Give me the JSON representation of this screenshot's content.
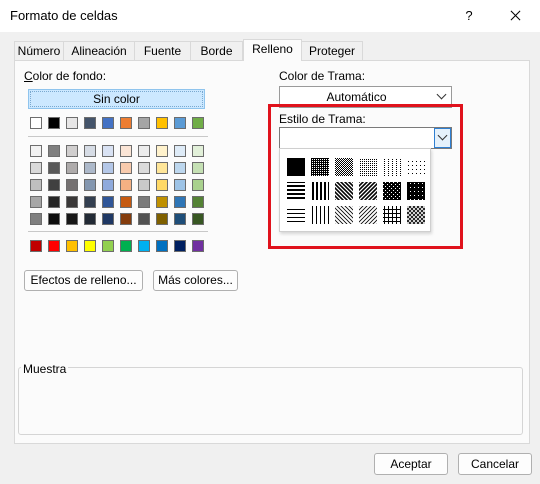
{
  "window": {
    "title": "Formato de celdas",
    "help": "?"
  },
  "tabs": [
    {
      "label": "Número"
    },
    {
      "label": "Alineación"
    },
    {
      "label": "Fuente"
    },
    {
      "label": "Borde"
    },
    {
      "label": "Relleno"
    },
    {
      "label": "Proteger"
    }
  ],
  "active_tab": "Relleno",
  "fill": {
    "background_label": "Color de fondo:",
    "no_color_label": "Sin color",
    "theme_top_row": [
      "#ffffff",
      "#000000",
      "#e7e6e6",
      "#44546a",
      "#4472c4",
      "#ed7d31",
      "#a5a5a5",
      "#ffc000",
      "#5b9bd5",
      "#70ad47"
    ],
    "theme_shades": [
      [
        "#f2f2f2",
        "#7f7f7f",
        "#d0cece",
        "#d6dce5",
        "#d9e2f3",
        "#fbe5d6",
        "#ededed",
        "#fff2cc",
        "#deebf7",
        "#e2f0d9"
      ],
      [
        "#d9d9d9",
        "#595959",
        "#aeabab",
        "#adb9ca",
        "#b4c7e7",
        "#f8cbad",
        "#dbdbdb",
        "#ffe699",
        "#bdd7ee",
        "#c5e0b4"
      ],
      [
        "#bfbfbf",
        "#404040",
        "#757171",
        "#8497b0",
        "#8faadc",
        "#f4b183",
        "#c9c9c9",
        "#ffd966",
        "#9dc3e6",
        "#a9d18e"
      ],
      [
        "#a6a6a6",
        "#262626",
        "#3a3838",
        "#333f50",
        "#2f5597",
        "#c55a11",
        "#7b7b7b",
        "#bf9000",
        "#2e75b6",
        "#548235"
      ],
      [
        "#7f7f7f",
        "#0d0d0d",
        "#171717",
        "#222a35",
        "#1f3864",
        "#843c0c",
        "#525252",
        "#7f6000",
        "#1f4e79",
        "#385723"
      ]
    ],
    "standard_colors": [
      "#c00000",
      "#ff0000",
      "#ffc000",
      "#ffff00",
      "#92d050",
      "#00b050",
      "#00b0f0",
      "#0070c0",
      "#002060",
      "#7030a0"
    ],
    "effects_button": "Efectos de relleno...",
    "more_colors_button": "Más colores..."
  },
  "pattern": {
    "color_label": "Color de Trama:",
    "color_value": "Automático",
    "style_label": "Estilo de Trama:",
    "style_value": "",
    "patterns": [
      [
        "solid",
        "75-gray",
        "50-gray",
        "25-gray",
        "12-gray",
        "6-gray"
      ],
      [
        "h-stripe",
        "v-stripe",
        "rev-diag",
        "diag",
        "diag-cross",
        "thick-cross"
      ],
      [
        "thin-h",
        "thin-v",
        "thin-rev-diag",
        "thin-diag",
        "thin-h-cross",
        "thin-diag-cross"
      ]
    ]
  },
  "sample": {
    "label": "Muestra"
  },
  "buttons": {
    "ok": "Aceptar",
    "cancel": "Cancelar"
  },
  "colors": {
    "highlight": "#e0121c",
    "accent": "#0078d4"
  }
}
